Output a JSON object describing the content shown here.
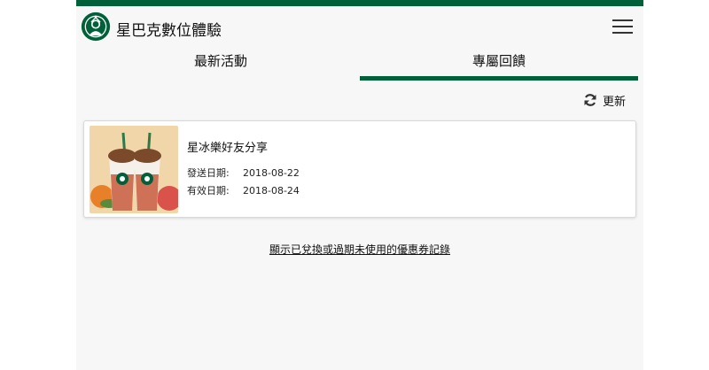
{
  "header": {
    "brand": "星巴克數位體驗",
    "menu_icon": "hamburger-menu-icon"
  },
  "tabs": [
    {
      "label": "最新活動",
      "active": false
    },
    {
      "label": "專屬回饋",
      "active": true
    }
  ],
  "toolbar": {
    "refresh_label": "更新",
    "refresh_icon": "refresh-icon"
  },
  "coupons": [
    {
      "title": "星冰樂好友分享",
      "send_date_label": "發送日期:",
      "send_date": "2018-08-22",
      "expire_date_label": "有效日期:",
      "expire_date": "2018-08-24"
    }
  ],
  "history_link": "顯示已兌換或過期未使用的優惠券記錄",
  "colors": {
    "brand_green": "#00603a",
    "background": "#f7f7f7"
  }
}
